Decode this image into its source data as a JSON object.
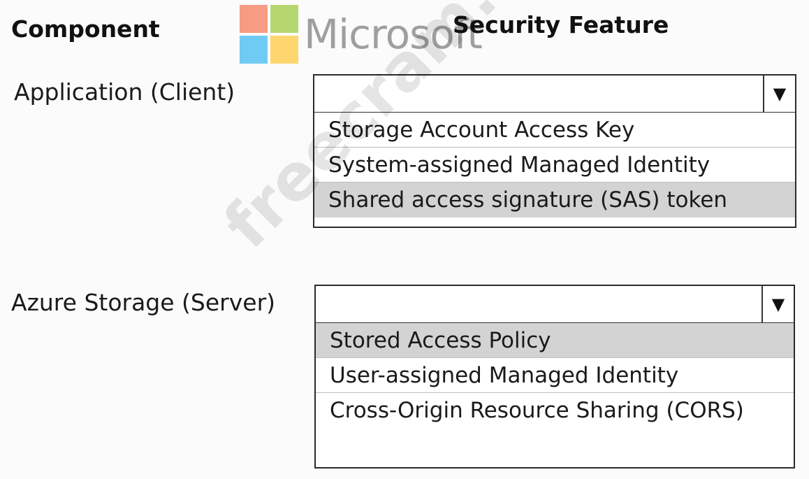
{
  "headers": {
    "component": "Component",
    "security_feature": "Security Feature"
  },
  "logo": {
    "wordmark": "Microsoft",
    "colors": [
      "#f25022",
      "#7fba00",
      "#00a4ef",
      "#ffb900"
    ]
  },
  "watermark": "freecram.net",
  "rows": [
    {
      "label": "Application (Client)",
      "selected_value": "",
      "options": [
        "Storage Account Access Key",
        "System-assigned Managed Identity",
        "Shared access signature (SAS) token"
      ],
      "highlighted_option": "Shared access signature (SAS) token"
    },
    {
      "label": "Azure Storage (Server)",
      "selected_value": "",
      "options": [
        "Stored Access Policy",
        "User-assigned Managed Identity",
        "Cross-Origin Resource Sharing (CORS)"
      ],
      "highlighted_option": "Stored Access Policy"
    }
  ],
  "icons": {
    "dropdown_arrow": "triangle-down-icon"
  }
}
